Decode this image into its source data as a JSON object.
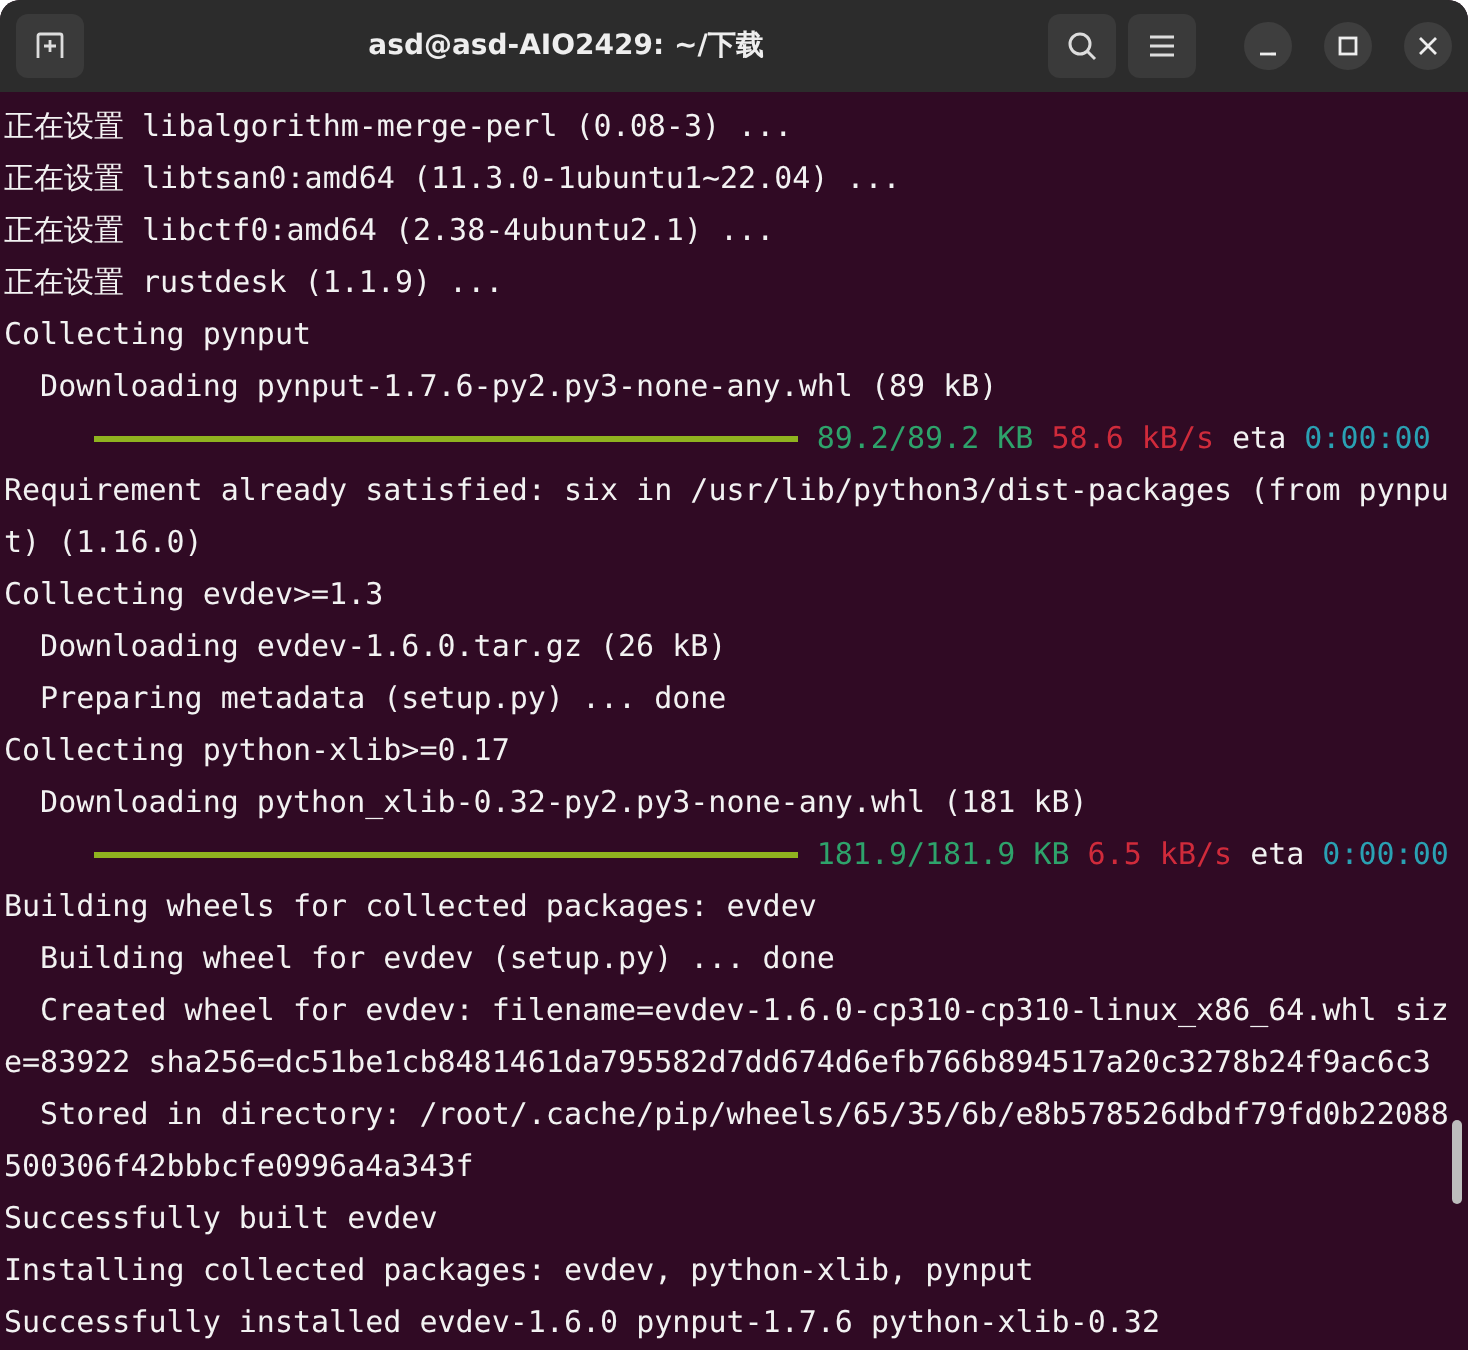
{
  "window": {
    "title": "asd@asd-AIO2429: ~/下载"
  },
  "lines": [
    {
      "kind": "text",
      "indent": false,
      "text": "正在设置 libalgorithm-merge-perl (0.08-3) ..."
    },
    {
      "kind": "text",
      "indent": false,
      "text": "正在设置 libtsan0:amd64 (11.3.0-1ubuntu1~22.04) ..."
    },
    {
      "kind": "text",
      "indent": false,
      "text": "正在设置 libctf0:amd64 (2.38-4ubuntu2.1) ..."
    },
    {
      "kind": "text",
      "indent": false,
      "text": "正在设置 rustdesk (1.1.9) ..."
    },
    {
      "kind": "text",
      "indent": false,
      "text": "Collecting pynput"
    },
    {
      "kind": "text",
      "indent": true,
      "text": "Downloading pynput-1.7.6-py2.py3-none-any.whl (89 kB)"
    },
    {
      "kind": "progress",
      "level": 1,
      "size": "89.2/89.2 KB",
      "speed": "58.6 kB/s",
      "eta_label": "eta",
      "eta": "0:00:00"
    },
    {
      "kind": "text",
      "indent": false,
      "text": "Requirement already satisfied: six in /usr/lib/python3/dist-packages (from pynpu"
    },
    {
      "kind": "text",
      "indent": false,
      "text": "t) (1.16.0)"
    },
    {
      "kind": "text",
      "indent": false,
      "text": "Collecting evdev>=1.3"
    },
    {
      "kind": "text",
      "indent": true,
      "text": "Downloading evdev-1.6.0.tar.gz (26 kB)"
    },
    {
      "kind": "text",
      "indent": true,
      "text": "Preparing metadata (setup.py) ... done"
    },
    {
      "kind": "text",
      "indent": false,
      "text": "Collecting python-xlib>=0.17"
    },
    {
      "kind": "text",
      "indent": true,
      "text": "Downloading python_xlib-0.32-py2.py3-none-any.whl (181 kB)"
    },
    {
      "kind": "progress",
      "level": 1,
      "size": "181.9/181.9 KB",
      "speed": "6.5 kB/s",
      "eta_label": "eta",
      "eta": "0:00:00"
    },
    {
      "kind": "text",
      "indent": false,
      "text": "Building wheels for collected packages: evdev"
    },
    {
      "kind": "text",
      "indent": true,
      "text": "Building wheel for evdev (setup.py) ... done"
    },
    {
      "kind": "text",
      "indent": true,
      "text": "Created wheel for evdev: filename=evdev-1.6.0-cp310-cp310-linux_x86_64.whl siz"
    },
    {
      "kind": "text",
      "indent": false,
      "text": "e=83922 sha256=dc51be1cb8481461da795582d7dd674d6efb766b894517a20c3278b24f9ac6c3"
    },
    {
      "kind": "text",
      "indent": true,
      "text": "Stored in directory: /root/.cache/pip/wheels/65/35/6b/e8b578526dbdf79fd0b22088"
    },
    {
      "kind": "text",
      "indent": false,
      "text": "500306f42bbbcfe0996a4a343f"
    },
    {
      "kind": "text",
      "indent": false,
      "text": "Successfully built evdev"
    },
    {
      "kind": "text",
      "indent": false,
      "text": "Installing collected packages: evdev, python-xlib, pynput"
    },
    {
      "kind": "text",
      "indent": false,
      "text": "Successfully installed evdev-1.6.0 pynput-1.7.6 python-xlib-0.32"
    }
  ]
}
